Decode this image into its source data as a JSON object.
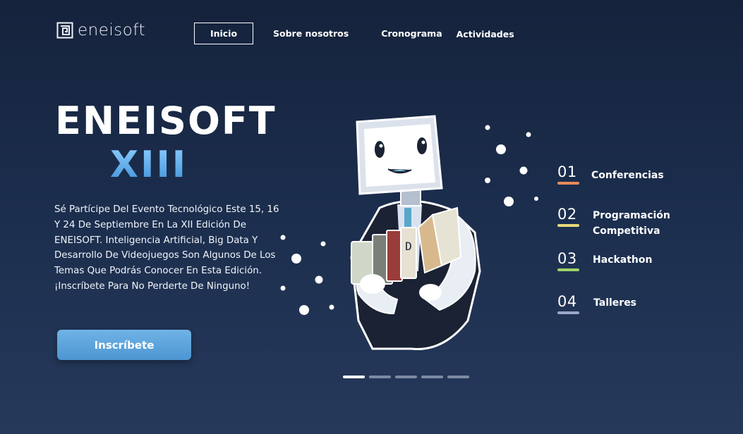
{
  "header": {
    "logo_text": "eneisoft",
    "nav": [
      {
        "label": "Inicio",
        "active": true
      },
      {
        "label": "Sobre nosotros",
        "active": false
      },
      {
        "label": "Cronograma",
        "active": false
      },
      {
        "label": "Actividades",
        "active": false
      }
    ]
  },
  "hero": {
    "title": "ENEISOFT",
    "subtitle": "XIII",
    "description": "Sé Partícipe Del Evento Tecnológico Este 15, 16 Y 24 De Septiembre En La XII Edición De ENEISOFT. Inteligencia Artificial, Big Data Y Desarrollo De Videojuegos Son Algunos De Los Temas Que Podrás Conocer En Esta Edición. ¡Inscríbete Para No Perderte De Ninguno!",
    "cta_label": "Inscríbete"
  },
  "illustration": {
    "icon": "robot-mascot-with-books",
    "badge_letter": "D"
  },
  "carousel": {
    "slide_count": 5,
    "active_index": 0
  },
  "activities": [
    {
      "number": "01",
      "label": "Conferencias",
      "color": "#e88a5a"
    },
    {
      "number": "02",
      "label": "Programación Competitiva",
      "label_line1": "Programación",
      "label_line2": "Competitiva",
      "color": "#e9d77a"
    },
    {
      "number": "03",
      "label": "Hackathon",
      "color": "#9ed36a"
    },
    {
      "number": "04",
      "label": "Talleres",
      "color": "#9aa7c9"
    }
  ],
  "colors": {
    "background_top": "#15223c",
    "background_bottom": "#26395b",
    "accent_blue": "#4d96d2",
    "subtitle_gradient": "#3d8fd8"
  }
}
